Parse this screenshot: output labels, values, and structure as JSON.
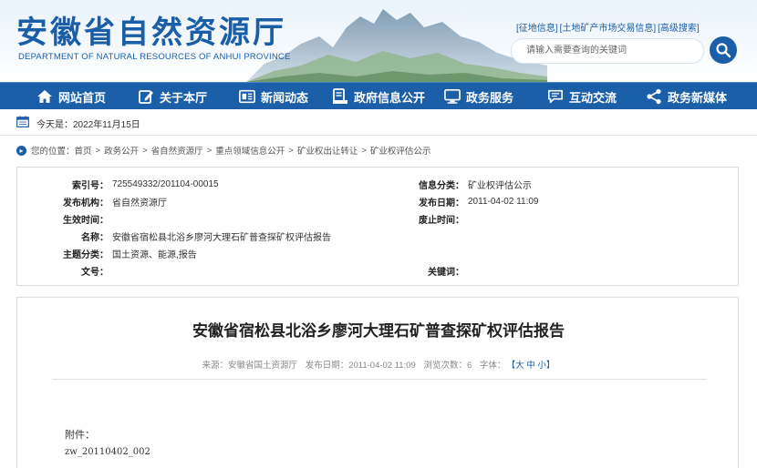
{
  "header": {
    "title": "安徽省自然资源厅",
    "subtitle": "DEPARTMENT OF NATURAL RESOURCES OF ANHUI PROVINCE",
    "top_links": [
      "[征地信息]",
      "[土地矿产市场交易信息]",
      "[高级搜索]"
    ],
    "search_placeholder": "请输入需要查询的关键词"
  },
  "nav": {
    "items": [
      {
        "label": "网站首页",
        "icon": "home-icon"
      },
      {
        "label": "关于本厅",
        "icon": "edit-icon"
      },
      {
        "label": "新闻动态",
        "icon": "news-icon"
      },
      {
        "label": "政府信息公开",
        "icon": "document-icon"
      },
      {
        "label": "政务服务",
        "icon": "monitor-icon"
      },
      {
        "label": "互动交流",
        "icon": "chat-icon"
      },
      {
        "label": "政务新媒体",
        "icon": "share-icon"
      }
    ]
  },
  "today": "今天是：2022年11月15日",
  "breadcrumb": {
    "prefix": "您的位置：",
    "items": [
      "首页",
      "政务公开",
      "省自然资源厅",
      "重点领域信息公开",
      "矿业权出让转让",
      "矿业权评估公示"
    ]
  },
  "meta": {
    "index_no_label": "索引号：",
    "index_no": "725549332/201104-00015",
    "category_label": "信息分类：",
    "category": "矿业权评估公示",
    "publisher_label": "发布机构：",
    "publisher": "省自然资源厅",
    "pubdate_label": "发布日期：",
    "pubdate": "2011-04-02 11:09",
    "effective_label": "生效时间：",
    "effective": "",
    "abolish_label": "废止时间：",
    "abolish": "",
    "name_label": "名称：",
    "name": "安徽省宿松县北浴乡廖河大理石矿普查探矿权评估报告",
    "topic_label": "主题分类：",
    "topic": "国土资源、能源,报告",
    "docno_label": "文号：",
    "docno": "",
    "keywords_label": "关键词：",
    "keywords": ""
  },
  "article": {
    "title": "安徽省宿松县北浴乡廖河大理石矿普查探矿权评估报告",
    "source": "来源：安徽省国土资源厅",
    "date": "发布日期：2011-04-02 11:09",
    "views": "浏览次数：6",
    "font_label": "字体：",
    "font_sizes": "【大 中 小】",
    "attachment_label": "附件：",
    "attachment_file": "zw_20110402_002"
  },
  "colors": {
    "brand": "#1a5ea8",
    "nav_bg": "#1b5fa9"
  }
}
